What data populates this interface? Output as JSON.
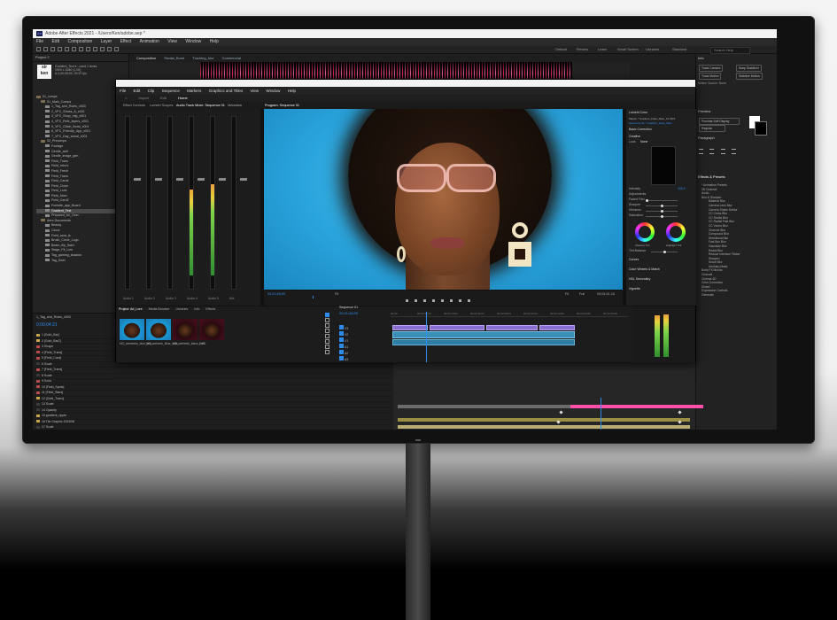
{
  "ae": {
    "title": "Adobe After Effects 2021 - /Users/Ken/adobe.aep *",
    "app_badge": "Ae",
    "menu": [
      "File",
      "Edit",
      "Composition",
      "Layer",
      "Effect",
      "Animation",
      "View",
      "Window",
      "Help"
    ],
    "workspaces": [
      "Default",
      "Review",
      "Learn",
      "Small Screen",
      "Libraries",
      "Standard"
    ],
    "search_placeholder": "Search Help",
    "project_label": "Project ≡",
    "comp_tabs": [
      "Composition",
      "Radial_Burst",
      "Tracking_blur",
      "Commercial"
    ],
    "project_tree": [
      {
        "name": "01_comps",
        "type": "folder"
      },
      {
        "name": "01_Main_Comps",
        "type": "folder"
      },
      {
        "name": "1_Tag_and_Rules_x003",
        "type": "comp"
      },
      {
        "name": "2_VFC_Shoes_A_x001",
        "type": "comp"
      },
      {
        "name": "3_VFC_Shop_mig_x001",
        "type": "comp"
      },
      {
        "name": "4_VFC_Refs_layers_x001",
        "type": "comp"
      },
      {
        "name": "5_VFC_Glitch_Burst_x001",
        "type": "comp"
      },
      {
        "name": "6_VFC_Friendly_App_x001",
        "type": "comp"
      },
      {
        "name": "7_VFC_Day_social_x001",
        "type": "comp"
      },
      {
        "name": "02_Precomps",
        "type": "folder"
      },
      {
        "name": "Footage",
        "type": "comp"
      },
      {
        "name": "Gentle_add",
        "type": "comp"
      },
      {
        "name": "Gentle_image_gen",
        "type": "comp"
      },
      {
        "name": "Field_Trans",
        "type": "comp"
      },
      {
        "name": "Field_intro's",
        "type": "comp"
      },
      {
        "name": "Field_Fresh",
        "type": "comp"
      },
      {
        "name": "Field_Trans",
        "type": "comp"
      },
      {
        "name": "Field_Cards",
        "type": "comp"
      },
      {
        "name": "Field_Close",
        "type": "comp"
      },
      {
        "name": "Field_Lock",
        "type": "comp"
      },
      {
        "name": "Field_Main",
        "type": "comp"
      },
      {
        "name": "Field_Card2",
        "type": "comp"
      },
      {
        "name": "Foresite_app_Board",
        "type": "comp"
      },
      {
        "name": "Gradient_Text",
        "type": "comp",
        "selected": true
      },
      {
        "name": "Prepared_for_Over",
        "type": "comp"
      },
      {
        "name": "Aere Documents",
        "type": "folder"
      },
      {
        "name": "Beauty",
        "type": "comp"
      },
      {
        "name": "Cloud",
        "type": "comp"
      },
      {
        "name": "Field_aura_ls",
        "type": "comp"
      },
      {
        "name": "Brush_Circle_Logo",
        "type": "comp"
      },
      {
        "name": "Beam_flip_flash",
        "type": "comp"
      },
      {
        "name": "Stage_Fit_Line",
        "type": "comp"
      },
      {
        "name": "Tag_gaming_shadow",
        "type": "comp"
      },
      {
        "name": "Tag_Swirl",
        "type": "comp"
      }
    ],
    "timeline": {
      "timecode": "0;00;04;21",
      "comp_name": "1_Tag_and_Rules_x003",
      "layers": [
        "1  [Gold_Bar]",
        "2  [Gold_Bar2]",
        "3  Shape",
        "4  [Field_Trans]",
        "5  [Field_Card]",
        "6  Scale",
        "7  [Field_Trans]",
        "8  Scale",
        "9  Solid",
        "10  [Field_Spots]",
        "11  [Field_Stars]",
        "12  [Gold_Trans]",
        "13  Scale",
        "14  Opacity",
        "15  gradient_ripple",
        "16  Tile Graphic 2023/08",
        "17  Scale",
        "18  Position",
        "19  glitch",
        "20  Field Ripple",
        "21  Position",
        "22  Opacity",
        "23  Position"
      ],
      "modes": [
        "None",
        "None",
        "None",
        "None",
        "None"
      ],
      "parent": [
        "No A",
        "No A",
        "No A",
        "No A",
        "No A"
      ],
      "value_labels": [
        "100.0,100.0",
        "100.0%",
        "960.0,540.0",
        "-20.0",
        "25.0"
      ],
      "track_matte_label": "14. Field Ripp..."
    },
    "right_panel": {
      "title": "Info",
      "render_label": "Composition",
      "buttons": [
        "Track Camera",
        "Warp Stabilizer",
        "Track Motion",
        "Stabilize Motion"
      ],
      "motion_source": "Motion Source: None",
      "preview": "Preview",
      "paragraph": "Paragraph",
      "fonts": "Proxima Soft Display",
      "align": "Regular",
      "effects_title": "Effects & Presets",
      "effects": [
        "* Animation Presets",
        "3D Channel",
        "Audio",
        "Blur & Sharpen",
        "Bilateral Blur",
        "Camera Lens Blur",
        "Camera Shake Deblur",
        "CC Cross Blur",
        "CC Radial Blur",
        "CC Radial Fast Blur",
        "CC Vector Blur",
        "Channel Blur",
        "Compound Blur",
        "Directional Blur",
        "Fast Box Blur",
        "Gaussian Blur",
        "Radial Blur",
        "Reduce Interlace Flicker",
        "Sharpen",
        "Smart Blur",
        "Unsharp Mask",
        "Boris FX Mocha",
        "Channel",
        "Cinema 4D",
        "Color Correction",
        "Distort",
        "Expression Controls",
        "Generate"
      ]
    }
  },
  "pr": {
    "menu": [
      "File",
      "Edit",
      "Clip",
      "Sequence",
      "Markers",
      "Graphics and Titles",
      "View",
      "Window",
      "Help"
    ],
    "workspace_home": "Home",
    "workspace_import": "Import",
    "workspace_edit": "Edit",
    "panel_tabs": [
      "Effect Controls",
      "Lumetri Scopes",
      "Audio Track Mixer: Sequence 01",
      "Metadata",
      "Audio Clip Mixer"
    ],
    "program_tab": "Program: Sequence 01",
    "program_tc_left": "00;01;48;09",
    "program_fit": "Fit",
    "program_full": "Full",
    "program_tc_right": "00;04;51;16",
    "mixer_labels": [
      "Audio 1",
      "Audio 2",
      "Audio 3",
      "Audio 4",
      "Audio 5",
      "Mix"
    ],
    "mixer_levels": [
      0.0,
      0.0,
      0.0,
      0.62,
      0.66,
      0.0
    ],
    "lumetri": {
      "title": "Lumetri Color",
      "master": "Master * Gradient_Fade_Main_01.MP4",
      "sequence": "Sequence 01 * Gradient_Fade_Main",
      "basic": "Basic Correction",
      "creative": "Creative",
      "look": "Look",
      "look_value": "None",
      "intensity": "Intensity",
      "adjustments": "Adjustments",
      "faded_film": "Faded Film",
      "sharpen": "Sharpen",
      "vibrance": "Vibrance",
      "saturation": "Saturation",
      "shadow_tint": "Shadow Tint",
      "highlight_tint": "Highlight Tint",
      "tint_balance": "Tint Balance",
      "curves": "Curves",
      "color_wheels": "Color Wheels & Match",
      "hsl": "HSL Secondary",
      "vignette": "Vignette",
      "values": [
        "100.0",
        "0.0",
        "0.0",
        "0.0",
        "100.0",
        "0.0"
      ]
    },
    "project_tabs": [
      "Project: Ad_Lore",
      "Media Browser",
      "Libraries",
      "Info",
      "Effects"
    ],
    "project_name": "Project: BFD 2021",
    "clips": [
      {
        "label": "HD_verbeeke_blue_red...",
        "dark": false
      },
      {
        "label": "HD_verbeek_Blue_side...",
        "dark": false
      },
      {
        "label": "HD_verbeek_black_red...",
        "dark": true
      },
      {
        "label": "2:05",
        "dark": true
      }
    ],
    "sequence_tab": "Sequence 01",
    "sequence_tc": "00;01;48;09",
    "ruler_ticks": [
      "00;00",
      "00;00;32;00",
      "00;01;04;02",
      "00;01;36;02",
      "00;02;08;04",
      "00;02;40;04",
      "00;03;12;06",
      "00;03;44;06",
      "00;04;16;08"
    ],
    "tracks": [
      "V3",
      "V2",
      "V1",
      "A1",
      "A2",
      "A3"
    ],
    "meter_levels": [
      0.85,
      0.88
    ]
  },
  "colors": {
    "accent": "#2d8ceb",
    "pink_bar": "#ff4fa8",
    "olive_bar": "#9a8d44",
    "tan_bar": "#b9ad74"
  }
}
